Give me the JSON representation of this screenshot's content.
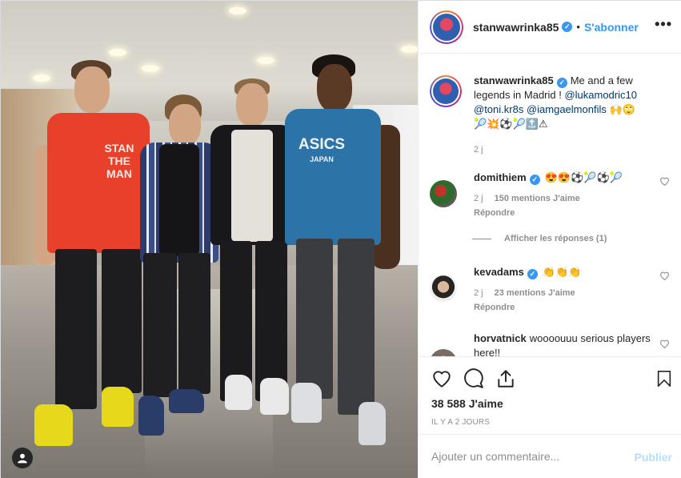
{
  "post": {
    "username": "stanwawrinka85",
    "verified": true,
    "follow_label": "S'abonner",
    "more_label": "•••",
    "caption": {
      "username": "stanwawrinka85",
      "text_1": "Me and a few legends in Madrid ! ",
      "mention_1": "@lukamodric10",
      "mention_2": "@toni.kr8s",
      "mention_3": "@iamgaelmonfils",
      "emojis": [
        "🙌",
        "🙄",
        "🎾",
        "💥",
        "⚽",
        "🎾",
        "🔝",
        "⚠"
      ],
      "time": "2 j"
    },
    "photo": {
      "shirt_1": "STAN THE MAN",
      "shirt_4_line1": "ASICS",
      "shirt_4_line2": "JAPAN"
    },
    "comments": [
      {
        "username": "domithiem",
        "verified": true,
        "emojis": [
          "😍",
          "😍",
          "⚽",
          "🎾",
          "⚽",
          "🎾"
        ],
        "time": "2 j",
        "likes": "150 mentions J'aime",
        "reply": "Répondre"
      },
      {
        "username": "kevadams",
        "verified": true,
        "emojis": [
          "👏",
          "👏",
          "👏"
        ],
        "time": "2 j",
        "likes": "23 mentions J'aime",
        "reply": "Répondre"
      },
      {
        "username": "horvatnick",
        "text": "woooouuu serious players here!!"
      }
    ],
    "view_replies": "Afficher les réponses (1)",
    "likes_count": "38 588 J'aime",
    "time_ago": "IL Y A 2 JOURS",
    "comment_placeholder": "Ajouter un commentaire...",
    "publish_label": "Publier"
  },
  "colors": {
    "link_blue": "#3897f0",
    "publish_disabled": "#b2dffc",
    "muted": "#8e8e8e"
  },
  "icons": [
    "heart-icon",
    "comment-icon",
    "share-icon",
    "bookmark-icon",
    "more-icon",
    "verified-icon",
    "user-tag-icon"
  ]
}
